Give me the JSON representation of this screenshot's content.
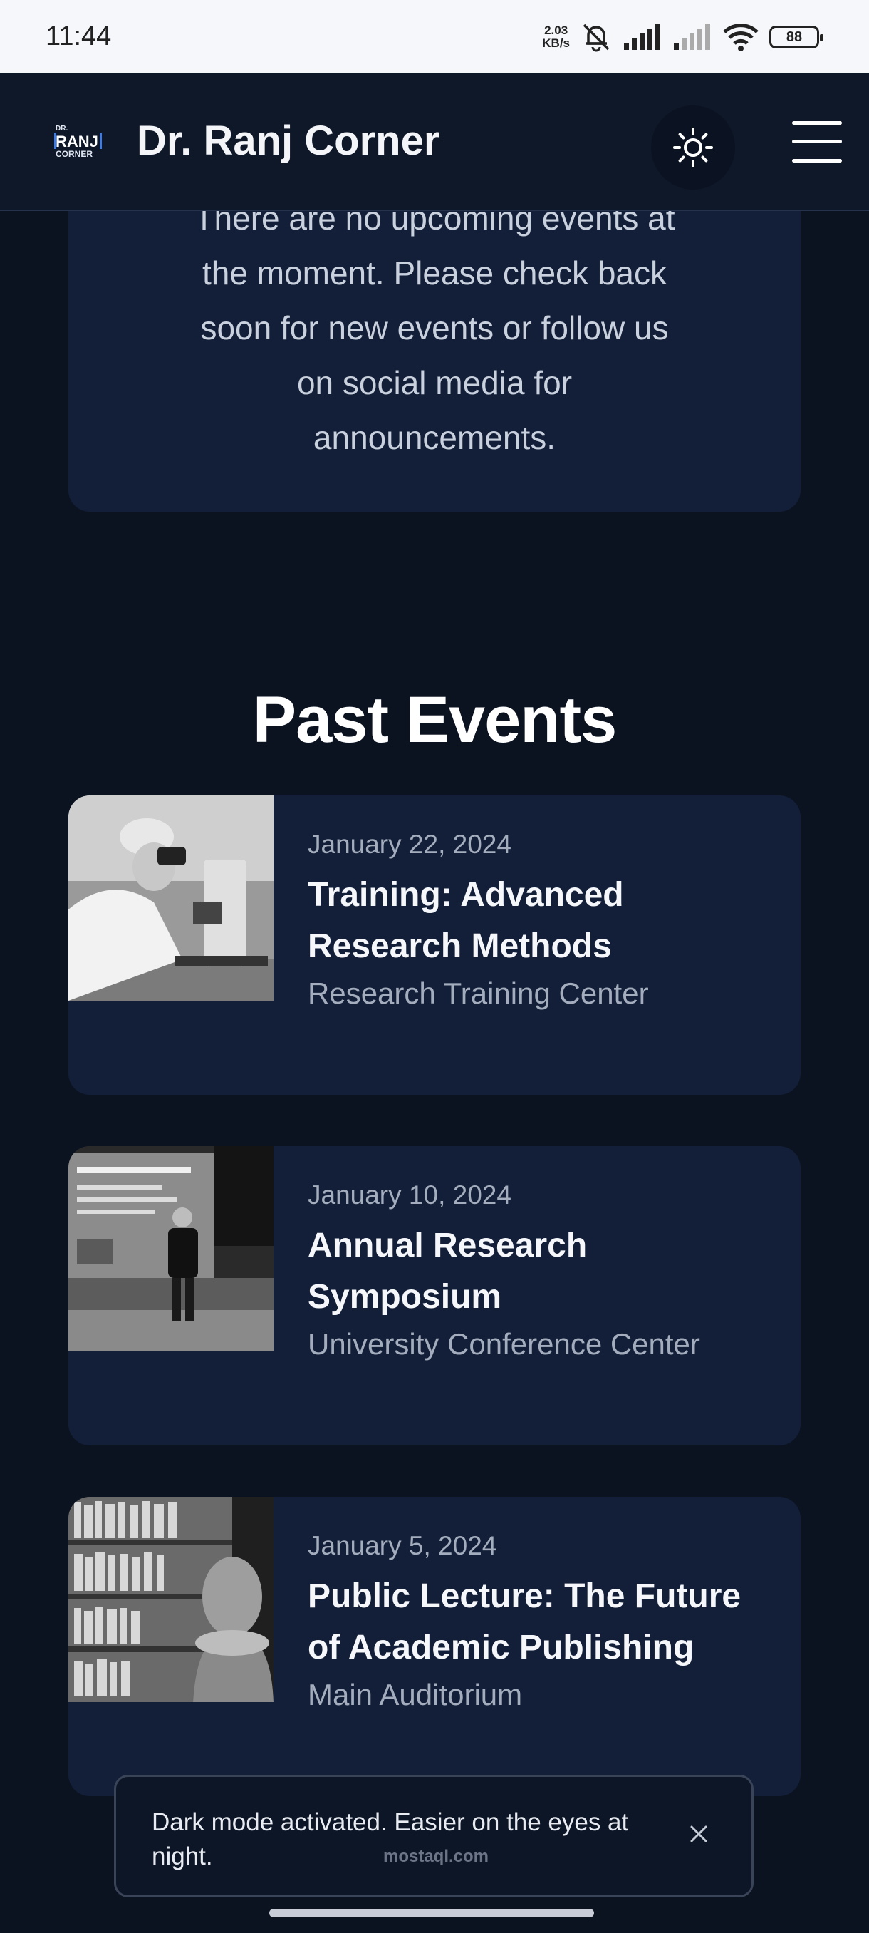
{
  "status_bar": {
    "time": "11:44",
    "network_speed_value": "2.03",
    "network_speed_unit": "KB/s",
    "battery": "88"
  },
  "header": {
    "logo_text": "DR. RANJ CORNER",
    "title": "Dr. Ranj Corner"
  },
  "upcoming": {
    "message": "There are no upcoming events at the moment. Please check back soon for new events or follow us on social media for announcements."
  },
  "past_events": {
    "title": "Past Events",
    "items": [
      {
        "date": "January 22, 2024",
        "title": "Training: Advanced Research Methods",
        "venue": "Research Training Center"
      },
      {
        "date": "January 10, 2024",
        "title": "Annual Research Symposium",
        "venue": "University Conference Center"
      },
      {
        "date": "January 5, 2024",
        "title": "Public Lecture: The Future of Academic Publishing",
        "venue": "Main Auditorium"
      }
    ]
  },
  "toast": {
    "message": "Dark mode activated. Easier on the eyes at night.",
    "close_icon": "close-icon",
    "watermark": "mostaql.com"
  },
  "colors": {
    "background": "#0b1220",
    "card": "#131f38",
    "header": "#0f1828",
    "muted_text": "#a3adbd"
  }
}
